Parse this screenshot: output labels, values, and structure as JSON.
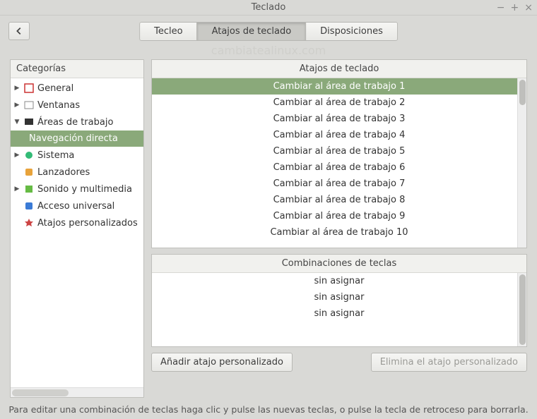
{
  "window": {
    "title": "Teclado"
  },
  "watermark": "cambiatealinux.com",
  "tabs": {
    "typing": "Tecleo",
    "shortcuts": "Atajos de teclado",
    "layouts": "Disposiciones"
  },
  "sidebar": {
    "header": "Categorías",
    "items": {
      "general": "General",
      "windows": "Ventanas",
      "workspaces": "Áreas de trabajo",
      "direct_nav": "Navegación directa",
      "system": "Sistema",
      "launchers": "Lanzadores",
      "sound": "Sonido y multimedia",
      "access": "Acceso universal",
      "custom": "Atajos personalizados"
    }
  },
  "shortcuts_panel": {
    "header": "Atajos de teclado",
    "rows": [
      "Cambiar al área de trabajo 1",
      "Cambiar al área de trabajo 2",
      "Cambiar al área de trabajo 3",
      "Cambiar al área de trabajo 4",
      "Cambiar al área de trabajo 5",
      "Cambiar al área de trabajo 6",
      "Cambiar al área de trabajo 7",
      "Cambiar al área de trabajo 8",
      "Cambiar al área de trabajo 9",
      "Cambiar al área de trabajo 10"
    ]
  },
  "combos_panel": {
    "header": "Combinaciones de teclas",
    "rows": [
      "sin asignar",
      "sin asignar",
      "sin asignar"
    ]
  },
  "buttons": {
    "add": "Añadir atajo personalizado",
    "remove": "Elimina el atajo personalizado"
  },
  "hint": "Para editar una combinación de teclas haga clic y pulse las nuevas teclas, o pulse la tecla de retroceso para borrarla."
}
